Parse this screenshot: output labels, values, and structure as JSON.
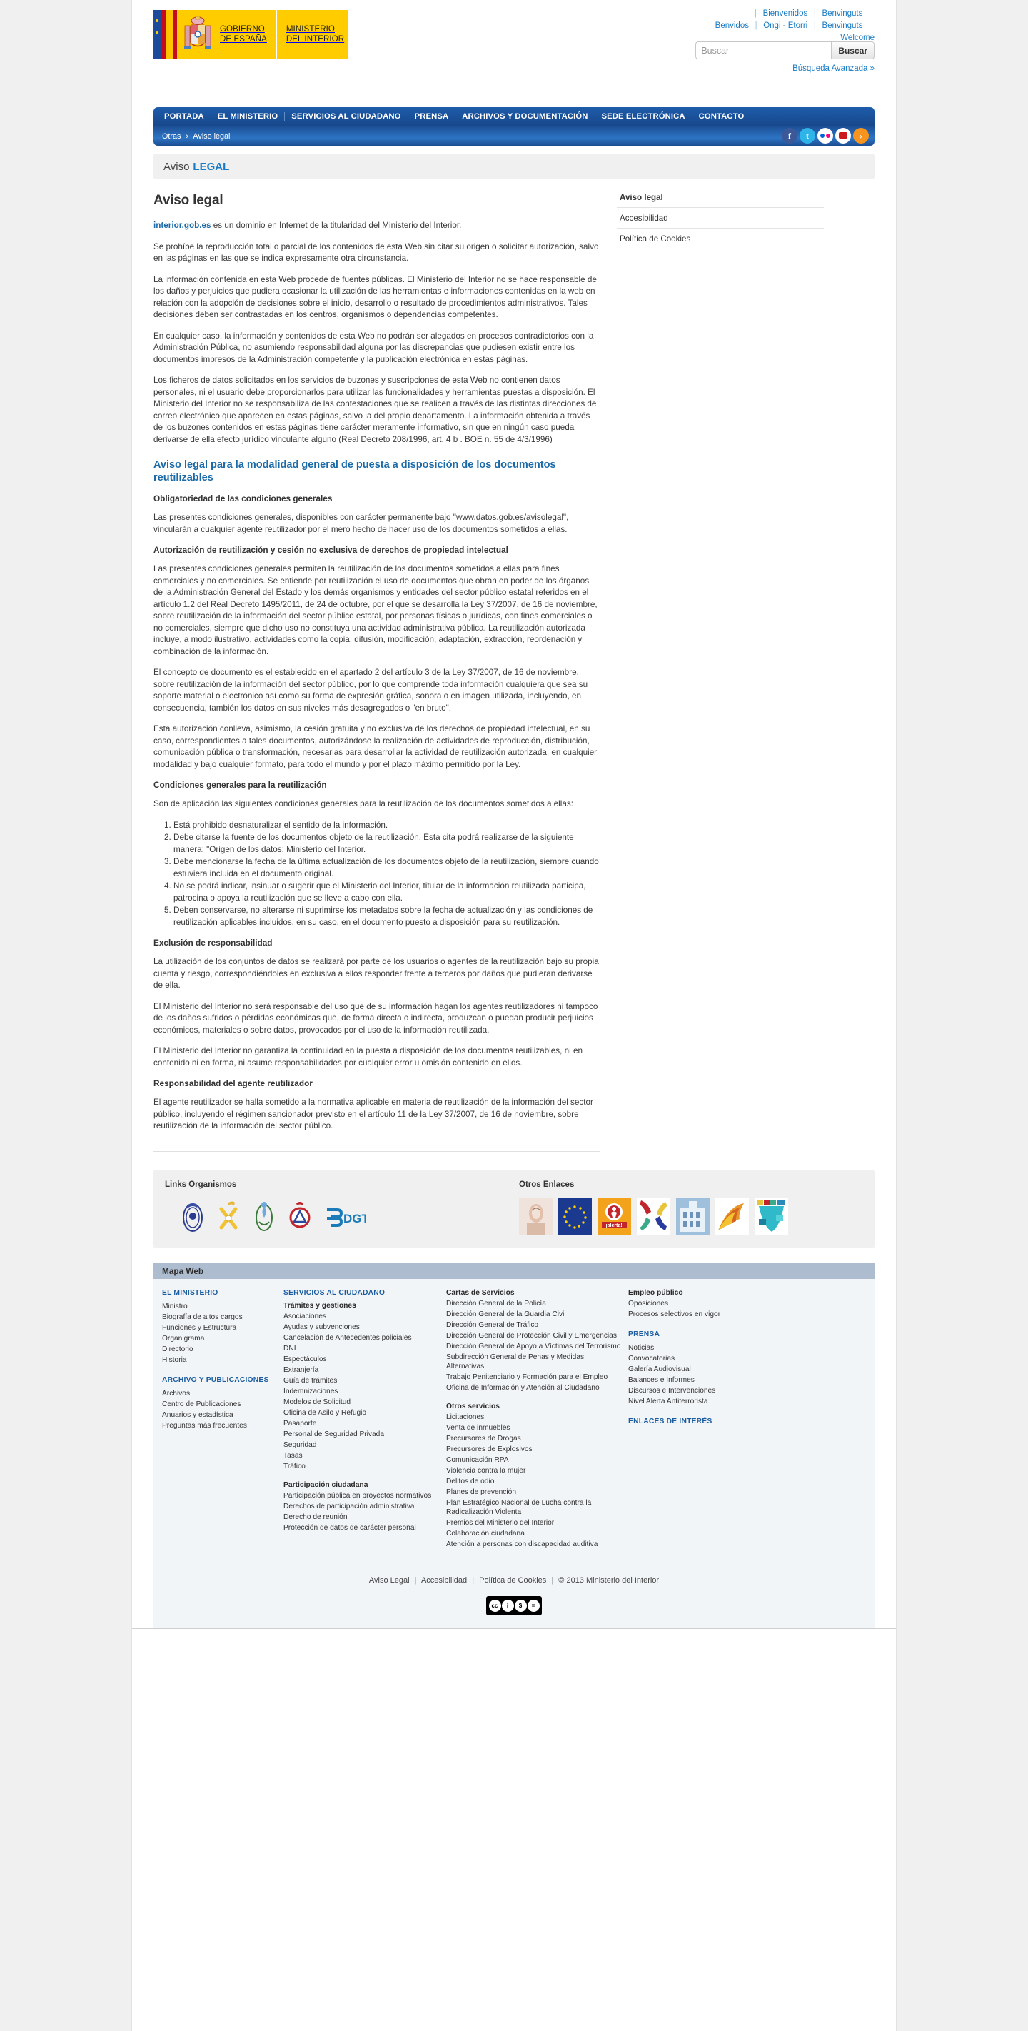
{
  "header": {
    "logo": {
      "gov_line1": "GOBIERNO",
      "gov_line2": "DE ESPAÑA",
      "min_line1": "MINISTERIO",
      "min_line2": "DEL INTERIOR"
    },
    "languages_row1": [
      "Bienvenidos",
      "Benvinguts"
    ],
    "languages_row2": [
      "Benvidos",
      "Ongi - Etorri",
      "Benvinguts"
    ],
    "languages_row3": [
      "Welcome"
    ],
    "search": {
      "placeholder": "Buscar",
      "value": "",
      "button": "Buscar",
      "advanced": "Búsqueda Avanzada »"
    }
  },
  "nav": {
    "items": [
      "PORTADA",
      "EL MINISTERIO",
      "SERVICIOS AL CIUDADANO",
      "PRENSA",
      "ARCHIVOS Y DOCUMENTACIÓN",
      "SEDE ELECTRÓNICA",
      "CONTACTO"
    ],
    "breadcrumb": {
      "root": "Otras",
      "arrow": "›",
      "current": "Aviso legal"
    },
    "social": [
      "facebook-icon",
      "twitter-icon",
      "flickr-icon",
      "youtube-icon",
      "rss-icon"
    ]
  },
  "titlebar": {
    "part1": "Aviso",
    "part2": "LEGAL"
  },
  "sidebar": {
    "items": [
      {
        "label": "Aviso legal",
        "current": true
      },
      {
        "label": "Accesibilidad",
        "current": false
      },
      {
        "label": "Política de Cookies",
        "current": false
      }
    ]
  },
  "main": {
    "h1": "Aviso legal",
    "intro_link": "interior.gob.es",
    "intro_rest": " es un dominio en Internet de la titularidad del Ministerio del Interior.",
    "p1": "Se prohíbe la reproducción total o parcial de los contenidos de esta Web sin citar su origen o solicitar autorización, salvo en las páginas en las que se indica expresamente otra circunstancia.",
    "p2": "La información contenida en esta Web procede de fuentes públicas. El Ministerio del Interior no se hace responsable de los daños y perjuicios que pudiera ocasionar la utilización de las herramientas e informaciones contenidas en la web en relación con la adopción de decisiones sobre el inicio, desarrollo o resultado de procedimientos administrativos. Tales decisiones deben ser contrastadas en los centros, organismos o dependencias competentes.",
    "p3": "En cualquier caso, la información y contenidos de esta Web no podrán ser alegados en procesos contradictorios con la Administración Pública, no asumiendo responsabilidad alguna por las discrepancias que pudiesen existir entre los documentos impresos de la Administración competente y la publicación electrónica en estas páginas.",
    "p4": "Los ficheros de datos solicitados en los servicios de buzones y suscripciones de esta Web no contienen datos personales, ni el usuario debe proporcionarlos para utilizar las funcionalidades y herramientas puestas a disposición. El Ministerio del Interior no se responsabiliza de las contestaciones que se realicen a través de las distintas direcciones de correo electrónico que aparecen en estas páginas, salvo la del propio departamento. La información obtenida a través de los buzones contenidos en estas páginas tiene carácter meramente informativo, sin que en ningún caso pueda derivarse de ella efecto jurídico vinculante alguno (Real Decreto 208/1996, art. 4 b . BOE n. 55 de 4/3/1996)",
    "h2": "Aviso legal para la modalidad general de puesta a disposición de los documentos reutilizables",
    "h3_1": "Obligatoriedad de las condiciones generales",
    "p5": "Las presentes condiciones generales, disponibles con carácter permanente bajo \"www.datos.gob.es/avisolegal\", vincularán a cualquier agente reutilizador por el mero hecho de hacer uso de los documentos sometidos a ellas.",
    "h3_2": "Autorización de reutilización y cesión no exclusiva de derechos de propiedad intelectual",
    "p6": "Las presentes condiciones generales permiten la reutilización de los documentos sometidos a ellas para fines comerciales y no comerciales. Se entiende por reutilización el uso de documentos que obran en poder de los órganos de la Administración General del Estado y los demás organismos y entidades del sector público estatal referidos en el artículo 1.2 del Real Decreto 1495/2011, de 24 de octubre, por el que se desarrolla la Ley 37/2007, de 16 de noviembre, sobre reutilización de la información del sector público estatal, por personas físicas o jurídicas, con fines comerciales o no comerciales, siempre que dicho uso no constituya una actividad administrativa pública. La reutilización autorizada incluye, a modo ilustrativo, actividades como la copia, difusión, modificación, adaptación, extracción, reordenación y combinación de la información.",
    "p7": "El concepto de documento es el establecido en el apartado 2 del artículo 3 de la Ley 37/2007, de 16 de noviembre, sobre reutilización de la información del sector público, por lo que comprende toda información cualquiera que sea su soporte material o electrónico así como su forma de expresión gráfica, sonora o en imagen utilizada, incluyendo, en consecuencia, también los datos en sus niveles más desagregados o \"en bruto\".",
    "p8": "Esta autorización conlleva, asimismo, la cesión gratuita y no exclusiva de los derechos de propiedad intelectual, en su caso, correspondientes a tales documentos, autorizándose la realización de actividades de reproducción, distribución, comunicación pública o transformación, necesarias para desarrollar la actividad de reutilización autorizada, en cualquier modalidad y bajo cualquier formato, para todo el mundo y por el plazo máximo permitido por la Ley.",
    "h3_3": "Condiciones generales para la reutilización",
    "p9": "Son de aplicación las siguientes condiciones generales para la reutilización de los documentos sometidos a ellas:",
    "conditions": [
      "Está prohibido desnaturalizar el sentido de la información.",
      "Debe citarse la fuente de los documentos objeto de la reutilización. Esta cita podrá realizarse de la siguiente manera: \"Origen de los datos: Ministerio del Interior.",
      "Debe mencionarse la fecha de la última actualización de los documentos objeto de la reutilización, siempre cuando estuviera incluida en el documento original.",
      "No se podrá indicar, insinuar o sugerir que el Ministerio del Interior, titular de la información reutilizada participa, patrocina o apoya la reutilización que se lleve a cabo con ella.",
      "Deben conservarse, no alterarse ni suprimirse los metadatos sobre la fecha de actualización y las condiciones de reutilización aplicables incluidos, en su caso, en el documento puesto a disposición para su reutilización."
    ],
    "h3_4": "Exclusión de responsabilidad",
    "p10": "La utilización de los conjuntos de datos se realizará por parte de los usuarios o agentes de la reutilización bajo su propia cuenta y riesgo, correspondiéndoles en exclusiva a ellos responder frente a terceros por daños que pudieran derivarse de ella.",
    "p11": "El Ministerio del Interior no será responsable del uso que de su información hagan los agentes reutilizadores ni tampoco de los daños sufridos o pérdidas económicas que, de forma directa o indirecta, produzcan o puedan producir perjuicios económicos, materiales o sobre datos, provocados por el uso de la información reutilizada.",
    "p12": "El Ministerio del Interior no garantiza la continuidad en la puesta a disposición de los documentos reutilizables, ni en contenido ni en forma, ni asume responsabilidades por cualquier error u omisión contenido en ellos.",
    "h3_5": "Responsabilidad del agente reutilizador",
    "p13": "El agente reutilizador se halla sometido a la normativa aplicable en materia de reutilización de la información del sector público, incluyendo el régimen sancionador previsto en el artículo 11 de la Ley 37/2007, de 16 de noviembre, sobre reutilización de la información del sector público."
  },
  "logos_band": {
    "left_title": "Links Organismos",
    "right_title": "Otros Enlaces",
    "left_logos": [
      "policia-nacional-crest-icon",
      "guardia-civil-crest-icon",
      "instituciones-penitenciarias-crest-icon",
      "proteccion-civil-crest-icon",
      "dgt-logo-icon"
    ],
    "right_logos": [
      "dni-electronico-icon",
      "union-europea-icon",
      "alerta-icon",
      "manos-icon",
      "edificio-icon",
      "abanico-icon",
      "mosaico-icon"
    ]
  },
  "mapa": {
    "title": "Mapa Web",
    "col1": {
      "heading1": "EL MINISTERIO",
      "list1": [
        "Ministro",
        "Biografía de altos cargos",
        "Funciones y Estructura",
        "Organigrama",
        "Directorio",
        "Historia"
      ],
      "heading2": "ARCHIVO Y PUBLICACIONES",
      "list2": [
        "Archivos",
        "Centro de Publicaciones",
        "Anuarios y estadística",
        "Preguntas más frecuentes"
      ]
    },
    "col2": {
      "heading1": "SERVICIOS AL CIUDADANO",
      "sub1": "Trámites y gestiones",
      "list1": [
        "Asociaciones",
        "Ayudas y subvenciones",
        "Cancelación de Antecedentes policiales",
        "DNI",
        "Espectáculos",
        "Extranjería",
        "Guía de trámites",
        "Indemnizaciones",
        "Modelos de Solicitud",
        "Oficina de Asilo y Refugio",
        "Pasaporte",
        "Personal de Seguridad Privada",
        "Seguridad",
        "Tasas",
        "Tráfico"
      ],
      "sub2": "Participación ciudadana",
      "list2": [
        "Participación pública en proyectos normativos",
        "Derechos de participación administrativa",
        "Derecho de reunión",
        "Protección de datos de carácter personal"
      ]
    },
    "col3": {
      "sub1": "Cartas de Servicios",
      "list1": [
        "Dirección General de la Policía",
        "Dirección General de la Guardia Civil",
        "Dirección General de Tráfico",
        "Dirección General de Protección Civil y Emergencias",
        "Dirección General de Apoyo a Víctimas del Terrorismo",
        "Subdirección General de Penas y Medidas Alternativas",
        "Trabajo Penitenciario y Formación para el Empleo",
        "Oficina de Información y Atención al Ciudadano"
      ],
      "sub2": "Otros servicios",
      "list2": [
        "Licitaciones",
        "Venta de inmuebles",
        "Precursores de Drogas",
        "Precursores de Explosivos",
        "Comunicación RPA",
        "Violencia contra la mujer",
        "Delitos de odio",
        "Planes de prevención",
        "Plan Estratégico Nacional de Lucha contra la Radicalización Violenta",
        "Premios del Ministerio del Interior",
        "Colaboración ciudadana",
        "Atención a personas con discapacidad auditiva"
      ]
    },
    "col4": {
      "sub1": "Empleo público",
      "list1": [
        "Oposiciones",
        "Procesos selectivos en vigor"
      ],
      "heading1": "PRENSA",
      "list2": [
        "Noticias",
        "Convocatorias",
        "Galería Audiovisual",
        "Balances e Informes",
        "Discursos e Intervenciones",
        "Nivel Alerta Antiterrorista"
      ],
      "heading2": "ENLACES DE INTERÉS"
    }
  },
  "footer": {
    "links": [
      "Aviso Legal",
      "Accesibilidad",
      "Política de Cookies"
    ],
    "copyright": "© 2013 Ministerio del Interior",
    "cc_badge": [
      "cc",
      "BY",
      "NC",
      "ND"
    ]
  }
}
